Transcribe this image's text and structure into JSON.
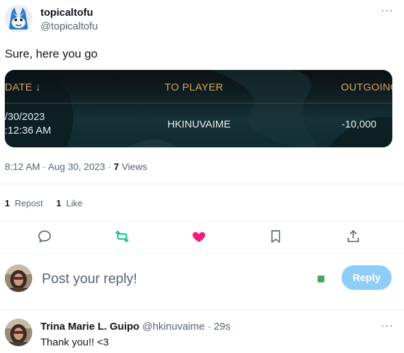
{
  "tweet": {
    "author_name": "topicaltofu",
    "author_handle": "@topicaltofu",
    "text": "Sure, here you go",
    "more_label": "···",
    "timestamp": "8:12 AM · Aug 30, 2023 · ",
    "views_count": "7",
    "views_label": " Views"
  },
  "media": {
    "col_date": "DATE ↓",
    "col_player": "TO PLAYER",
    "col_outgoing": "OUTGOING",
    "row_date_line1": "/30/2023",
    "row_date_line2": ":12:36 AM",
    "row_player": "HKINUVAIME",
    "row_outgoing": "-10,000"
  },
  "stats": {
    "reposts_count": "1",
    "reposts_label": "Repost",
    "likes_count": "1",
    "likes_label": "Like"
  },
  "actions": [
    "reply-icon",
    "repost-icon",
    "like-icon",
    "bookmark-icon",
    "share-icon"
  ],
  "composer": {
    "placeholder": "Post your reply!",
    "button_label": "Reply"
  },
  "reply": {
    "author_name": "Trina Marie L. Guipo",
    "author_handle": "@hkinuvaime",
    "time": " · 29s",
    "text": "Thank you!! <3",
    "more_label": "···"
  },
  "colors": {
    "like": "#f91880",
    "repost": "#00ba7c",
    "reply_button": "#8ecdf8"
  }
}
